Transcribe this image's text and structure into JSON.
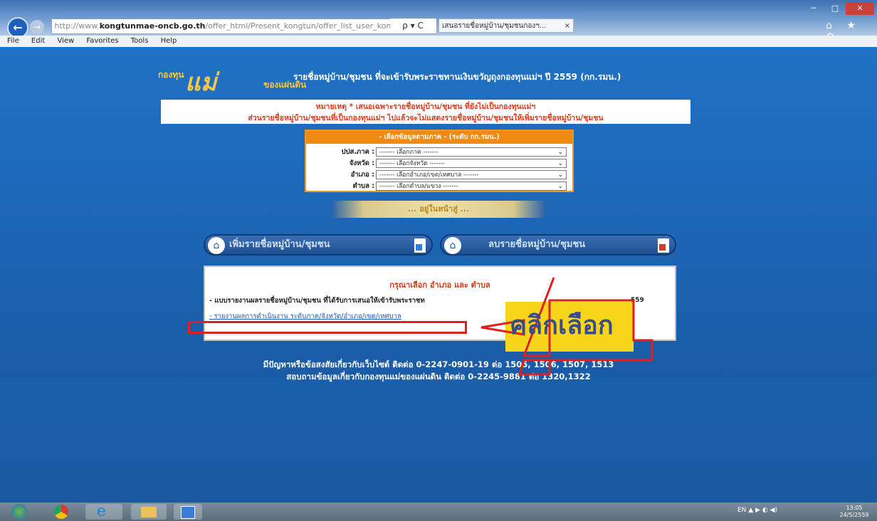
{
  "browser": {
    "back_icon": "back-arrow-icon",
    "address_prefix": "http://www.",
    "address_domain": "kongtunmae-oncb.go.th",
    "address_path": "/offer_html/Present_kongtun/offer_list_user_komm.php",
    "address_controls": "ρ ▾ C",
    "tab_title": "เสนอรายชื่อหมู่บ้าน/ชุมชนกองฯ...",
    "tab_close": "×",
    "window_controls": [
      "─",
      "□",
      "✕"
    ],
    "ie_icons": "⌂ ★ ⚙",
    "menu": [
      "File",
      "Edit",
      "View",
      "Favorites",
      "Tools",
      "Help"
    ]
  },
  "header": {
    "logo_top": "กองทุน",
    "logo_script": "แม่",
    "logo_bottom": "ของแผ่นดิน",
    "title": "รายชื่อหมู่บ้าน/ชุมชน ที่จะเข้ารับพระราชทานเงินขวัญถุงกองทุนแม่ฯ ปี 2559 (กก.รมน.)"
  },
  "note": {
    "line1": "หมายเหตุ * เสนอเฉพาะรายชื่อหมู่บ้าน/ชุมชน ที่ยังไม่เป็นกองทุนแม่ฯ",
    "line2": "ส่วนรายชื่อหมู่บ้าน/ชุมชนที่เป็นกองทุนแม่ฯ ไปแล้วจะไม่แสดงรายชื่อหมู่บ้าน/ชุมชนให้เพิ่มรายชื่อหมู่บ้าน/ชุมชน"
  },
  "filter_form": {
    "heading": "- เลือกข้อมูลตามภาค - (ระดับ กก.รมน.)",
    "rows": [
      {
        "label": "ปปส.ภาค :",
        "value": "------- เลือกภาค -------"
      },
      {
        "label": "จังหวัด :",
        "value": "------- เลือกจังหวัด -------"
      },
      {
        "label": "อำเภอ :",
        "value": "------- เลือกอำเภอ/เขต/เทศบาล -------"
      },
      {
        "label": "ตำบล :",
        "value": "------- เลือกตำบล/แขวง -------"
      }
    ],
    "chevron_icon": "chevron-down-icon",
    "search_label": "... อยู่ในหน้าสู่ ..."
  },
  "actions": {
    "add_label": "เพิ่มรายชื่อหมู่บ้าน/ชุมชน",
    "remove_label": "ลบรายชื่อหมู่บ้าน/ชุมชน",
    "home_icon": "home-icon",
    "doc_icon": "document-icon",
    "add_mark_color": "#2f7fd8",
    "remove_mark_color": "#d43a2a"
  },
  "result": {
    "title": "กรุณาเลือก อำเภอ และ ตำบล",
    "line1": "- แบบรายงานผลรายชื่อหมู่บ้าน/ชุมชน ที่ได้รับการเสนอให้เข้ารับพระราชท",
    "line1_end": "559",
    "line2": "- รายงานผลการดำเนินงาน ระดับภาค/จังหวัด/อำเภอ/เขต/เทศบาล"
  },
  "annotation": {
    "callout_text": "คลิกเลือก",
    "arrow_color": "#e02020",
    "callout_color": "#f6d51b"
  },
  "footer": {
    "line1": "มีปัญหาหรือข้อสงสัยเกี่ยวกับเว็บไซต์ ติดต่อ 0-2247-0901-19 ต่อ 1505, 1506, 1507, 1513",
    "line2": "สอบถามข้อมูลเกี่ยวกับกองทุนแม่ของแผ่นดิน ติดต่อ 0-2245-9881 ต่อ 1320,1322"
  },
  "taskbar": {
    "tray_text": "EN  ▲  ▶  ◐  ◀)",
    "clock_time": "13:05",
    "clock_date": "24/5/2559"
  }
}
